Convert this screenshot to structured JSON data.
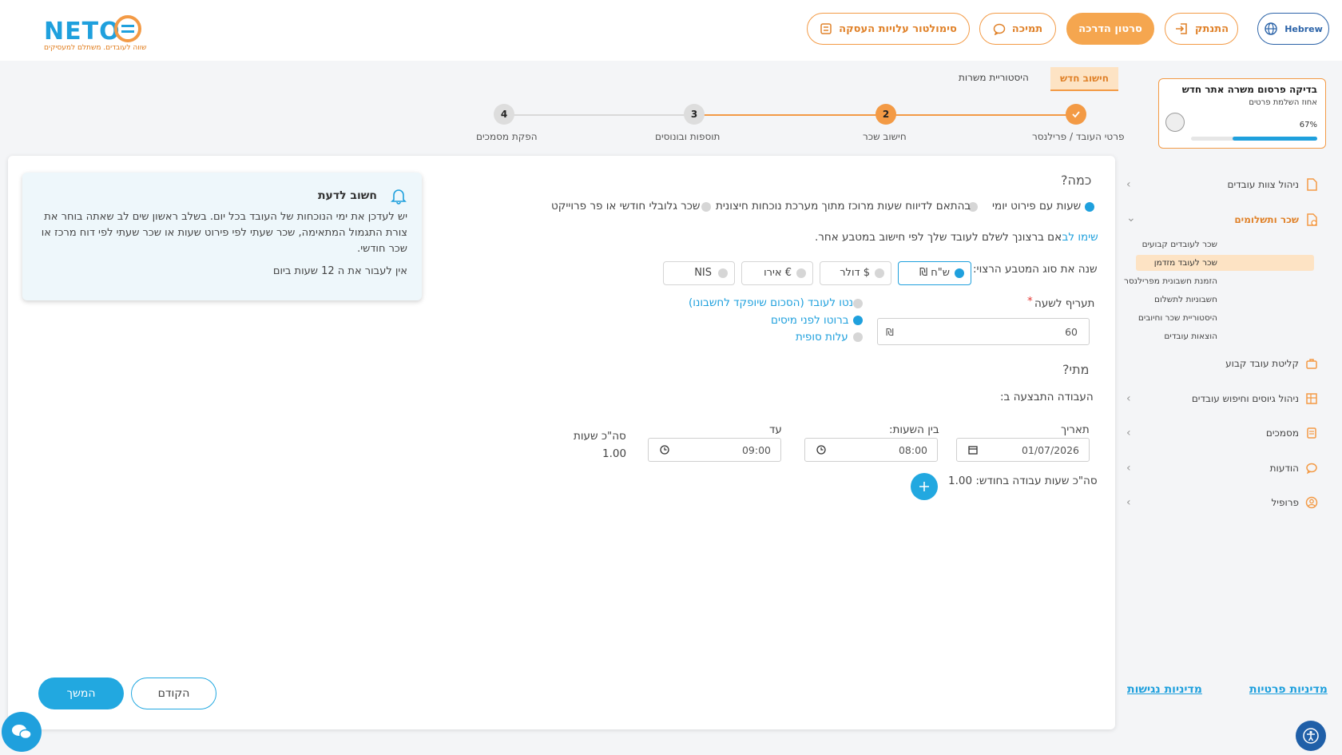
{
  "header": {
    "logo_text": "NETO",
    "logo_tagline": "שווה לעובדים. משתלם למעסיקים",
    "lang_label": "Hebrew",
    "logout_label": "התנתק",
    "tutorial_label": "סרטון הדרכה",
    "support_label": "תמיכה",
    "simulator_label": "סימולטור עלויות העסקה"
  },
  "sidebar": {
    "profile_card": {
      "title": "בדיקה פרסום משרה אתר חדש",
      "subtitle": "אחוז השלמת פרטים",
      "percent_text": "67%",
      "progress": 0.67
    },
    "items": [
      {
        "label": "ניהול צוות עובדים",
        "icon": "document-icon"
      },
      {
        "label": "שכר ותשלומים",
        "icon": "wallet-icon"
      },
      {
        "label": "קליטת עובד קבוע",
        "icon": "briefcase-icon"
      },
      {
        "label": "ניהול גיוסים וחיפוש עובדים",
        "icon": "grid-icon"
      },
      {
        "label": "מסמכים",
        "icon": "documents-icon"
      },
      {
        "label": "הודעות",
        "icon": "chat-icon"
      },
      {
        "label": "פרופיל",
        "icon": "user-icon"
      }
    ],
    "subitems": [
      "שכר לעובדים קבועים",
      "שכר לעובד מזדמן",
      "הזמנת חשבונית מפרילנסר",
      "חשבוניות לתשלום",
      "היסטוריית שכר וחיובים",
      "הוצאות עובדים"
    ],
    "footer_privacy": "מדיניות פרטיות",
    "footer_accessibility": "מדיניות נגישות"
  },
  "tabs": {
    "new_calc": "חישוב חדש",
    "history": "היסטוריית משרות"
  },
  "steps": [
    {
      "number": "",
      "label": "פרטי העובד / פרילנסר"
    },
    {
      "number": "2",
      "label": "חישוב שכר"
    },
    {
      "number": "3",
      "label": "תוספות ובונוסים"
    },
    {
      "number": "4",
      "label": "הפקת מסמכים"
    }
  ],
  "form": {
    "how_much_title": "כמה?",
    "pay_options": [
      "שעות עם פירוט יומי",
      "בהתאם לדיווח שעות מרוכז מתוך מערכת נוכחות חיצונית",
      "שכר גלובלי חודשי או פר פרוייקט"
    ],
    "note_prefix": "שימו לב:",
    "note_text": "אם ברצונך לשלם לעובד שלך לפי חישוב במטבע אחר.",
    "currency_prompt": "שנה את סוג המטבע הרצוי:",
    "currencies": [
      "ש\"ח ₪",
      "$ דולר",
      "€ אירו",
      "NIS"
    ],
    "rate_label": "תעריף לשעה",
    "rate_required": "*",
    "rate_value": "60",
    "rate_symbol": "₪",
    "rate_types": [
      "נטו לעובד (הסכום שיופקד לחשבונו)",
      "ברוטו לפני מיסים",
      "עלות סופית"
    ],
    "when_title": "מתי?",
    "work_done_label": "העבודה התבצעה ב:",
    "date_label": "תאריך",
    "date_value": "01/07/2026",
    "between_hours_label": "בין השעות:",
    "from_time": "08:00",
    "until_label": "עד",
    "to_time": "09:00",
    "total_hours_label": "סה\"כ שעות",
    "total_hours_value": "1.00",
    "monthly_total": "סה\"כ שעות עבודה בחודש: 1.00"
  },
  "info_box": {
    "title": "חשוב לדעת",
    "body": "יש לעדכן את ימי הנוכחות של העובד בכל יום. בשלב ראשון שים לב שאתה בוחר את צורת התגמול המתאימה, שכר שעתי לפי פירוט שעות או שכר שעתי לפי דוח מרכז או שכר חודשי.",
    "note": "אין לעבור את ה 12 שעות ביום"
  },
  "buttons": {
    "continue": "המשך",
    "previous": "הקודם"
  },
  "colors": {
    "orange": "#f39a45",
    "blue": "#1fa0dd",
    "dark_blue": "#2b63a8"
  }
}
